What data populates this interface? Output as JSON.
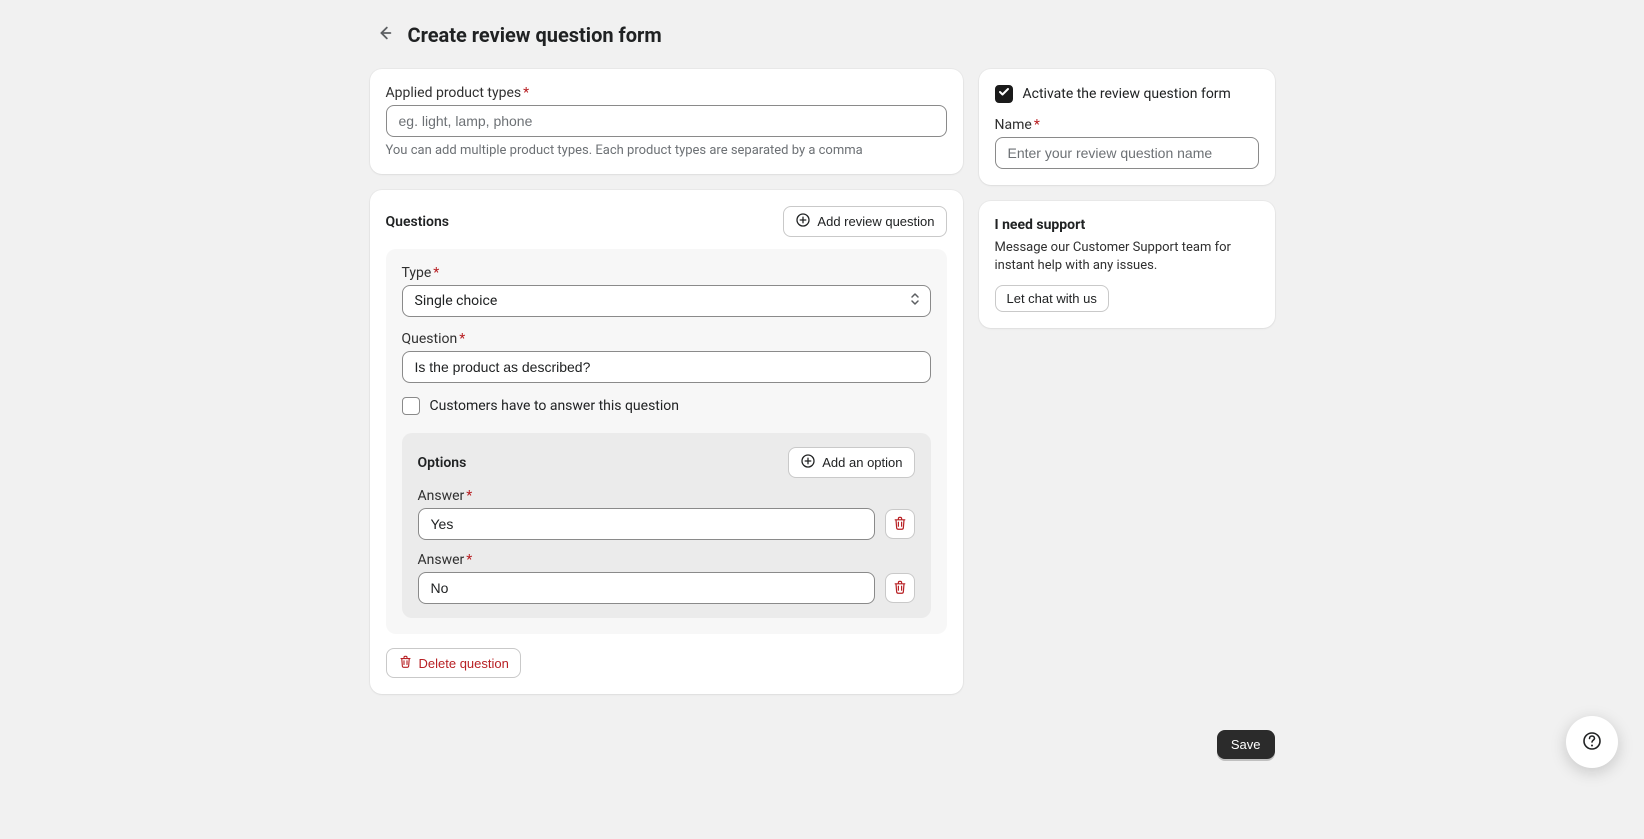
{
  "header": {
    "title": "Create review question form"
  },
  "main": {
    "productTypes": {
      "label": "Applied product types",
      "placeholder": "eg. light, lamp, phone",
      "value": "",
      "help": "You can add multiple product types. Each product types are separated by a comma"
    },
    "questions": {
      "heading": "Questions",
      "addButton": "Add review question",
      "item": {
        "typeLabel": "Type",
        "typeValue": "Single choice",
        "questionLabel": "Question",
        "questionValue": "Is the product as described?",
        "requiredCheckboxLabel": "Customers have to answer this question",
        "requiredChecked": false,
        "options": {
          "heading": "Options",
          "addButton": "Add an option",
          "answerLabel": "Answer",
          "answers": [
            "Yes",
            "No"
          ]
        },
        "deleteLabel": "Delete question"
      }
    }
  },
  "sidebar": {
    "activate": {
      "label": "Activate the review question form",
      "checked": true
    },
    "name": {
      "label": "Name",
      "placeholder": "Enter your review question name",
      "value": ""
    },
    "support": {
      "heading": "I need support",
      "body": "Message our Customer Support team for instant help with any issues.",
      "button": "Let chat with us"
    }
  },
  "footer": {
    "save": "Save"
  }
}
